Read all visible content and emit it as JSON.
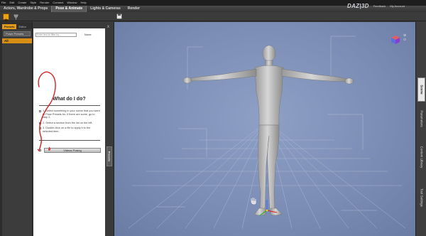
{
  "menu": [
    "File",
    "Edit",
    "Create",
    "Style",
    "Render",
    "Connect",
    "Window",
    "Help"
  ],
  "tabs": [
    {
      "label": "Actors, Wardrobe & Props",
      "active": false
    },
    {
      "label": "Pose & Animate",
      "active": true
    },
    {
      "label": "Lights & Cameras",
      "active": false
    },
    {
      "label": "Render",
      "active": false
    }
  ],
  "brand": {
    "logo": "DAZ|3D",
    "feedback": "Feedback",
    "account": "My Account"
  },
  "toolbar": {
    "pose_icon": "pose-figure-icon",
    "pin_icon": "pin-icon",
    "save_icon": "save-icon"
  },
  "presets_panel": {
    "tabs": [
      "Presets",
      "Editor"
    ],
    "select_value": "Poser Presets",
    "category": "All"
  },
  "content_panel": {
    "search_placeholder": "Enter text to filter by...",
    "none_label": "None",
    "title": "What do I do?",
    "steps": [
      "1. Select something in your scene that you want to Pose Presets for. If there are some, go to step 2.",
      "2. Select a section from the list on the left.",
      "3. Double-click on a file to apply it to the selected item."
    ],
    "video_button": "Videos Posing"
  },
  "side_tab": "Presets",
  "close_glyph": "x",
  "right_tabs": [
    {
      "label": "Scene",
      "active": true
    },
    {
      "label": "Parameters",
      "active": false
    },
    {
      "label": "Content Library",
      "active": false
    },
    {
      "label": "Tool Settings",
      "active": false
    }
  ],
  "colors": {
    "accent": "#e29a18",
    "viewport": "#7d8fb6",
    "figure": "#c4c4c4"
  }
}
